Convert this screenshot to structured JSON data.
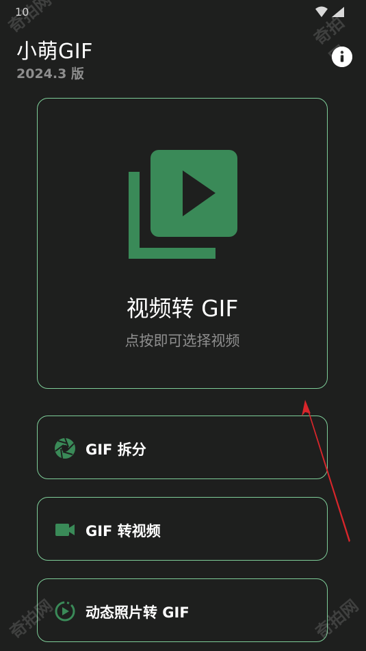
{
  "status_bar": {
    "time": "10"
  },
  "app": {
    "title": "小萌GIF",
    "version": "2024.3 版"
  },
  "main_card": {
    "title": "视频转 GIF",
    "subtitle": "点按即可选择视频"
  },
  "options": [
    {
      "label": "GIF 拆分",
      "icon": "aperture-icon"
    },
    {
      "label": "GIF 转视频",
      "icon": "video-camera-icon"
    },
    {
      "label": "动态照片转 GIF",
      "icon": "live-photo-icon"
    }
  ],
  "colors": {
    "accent": "#3a8a58",
    "border": "#7fcf9a",
    "background": "#1e1f1e"
  },
  "watermark": "奇拍网"
}
